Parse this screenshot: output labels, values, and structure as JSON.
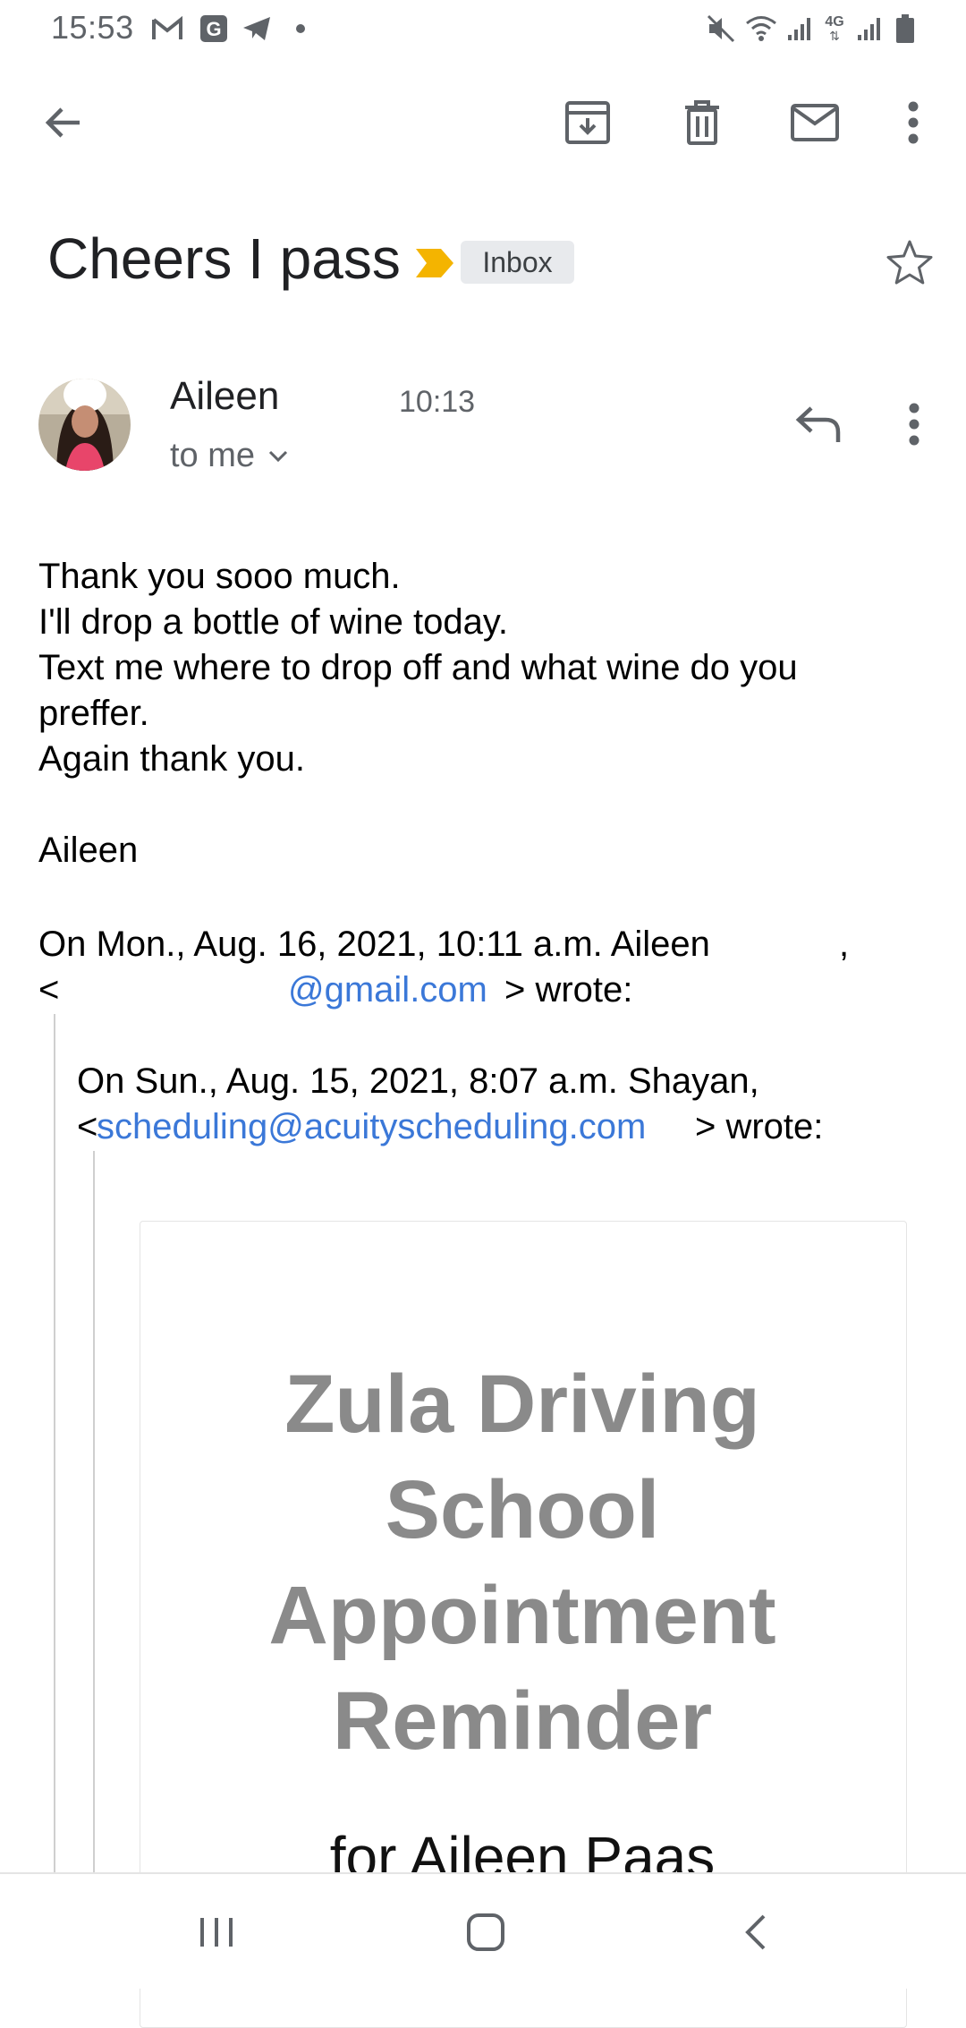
{
  "status_bar": {
    "time": "15:53",
    "icons": [
      "gmail-icon",
      "google-icon",
      "telegram-icon",
      "dot-icon",
      "mute-icon",
      "wifi-icon",
      "signal-icon",
      "4g-signal-icon",
      "battery-icon"
    ],
    "network_label": "4G"
  },
  "toolbar": {
    "back": "back-arrow-icon",
    "archive": "archive-icon",
    "delete": "delete-icon",
    "mark_unread": "mail-icon",
    "more": "more-vert-icon"
  },
  "email": {
    "subject": "Cheers I pass",
    "label": "Inbox",
    "important_color": "#F4B400",
    "sender": "Aileen",
    "time": "10:13",
    "recipient": "to me",
    "body_lines": [
      "Thank you sooo much.",
      "I'll drop a bottle of wine today.",
      "Text me where to drop off and what wine do you",
      "preffer.",
      "Again thank you.",
      "Aileen"
    ],
    "quote1": {
      "line1": "On Mon., Aug. 16, 2021, 10:11 a.m. Aileen",
      "line1_tail": ",",
      "line2_start": "<",
      "email_visible": "@gmail.com",
      "line2_end": "> wrote:"
    },
    "quote2": {
      "line1": "On Sun., Aug. 15, 2021, 8:07 a.m. Shayan,",
      "line2_start": "<",
      "email": "scheduling@acuityscheduling.com",
      "line2_end": "> wrote:"
    },
    "reminder": {
      "title_lines": [
        "Zula Driving",
        "School",
        "Appointment",
        "Reminder"
      ],
      "subtitle": "for Aileen Paas"
    }
  },
  "nav_bar": {
    "recents": "recents-icon",
    "home": "home-icon",
    "back": "nav-back-icon"
  },
  "colors": {
    "link": "#3B78D8",
    "badge_bg": "#E8EAED",
    "reminder_title": "#8A8A8A"
  }
}
